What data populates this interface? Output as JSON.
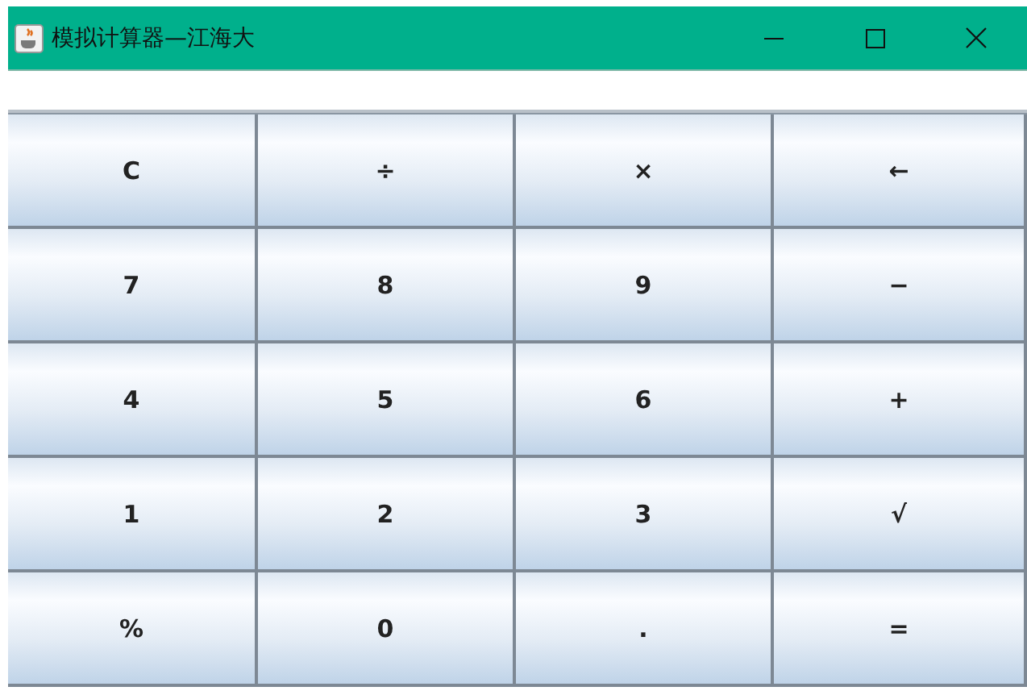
{
  "window": {
    "title": "模拟计算器—江海大"
  },
  "keys": [
    {
      "label": "C"
    },
    {
      "label": "÷"
    },
    {
      "label": "×"
    },
    {
      "label": "←"
    },
    {
      "label": "7"
    },
    {
      "label": "8"
    },
    {
      "label": "9"
    },
    {
      "label": "−"
    },
    {
      "label": "4"
    },
    {
      "label": "5"
    },
    {
      "label": "6"
    },
    {
      "label": "+"
    },
    {
      "label": "1"
    },
    {
      "label": "2"
    },
    {
      "label": "3"
    },
    {
      "label": "√"
    },
    {
      "label": "%"
    },
    {
      "label": "0"
    },
    {
      "label": "."
    },
    {
      "label": "="
    }
  ]
}
